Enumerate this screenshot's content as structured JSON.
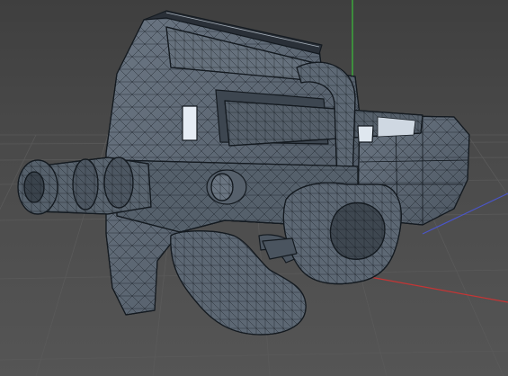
{
  "viewport": {
    "kind": "3d-modeling-viewport",
    "display_mode": "wireframe-on-shaded",
    "background_color": "#4a4a4a",
    "grid_color": "#5c5c5c",
    "model": {
      "description_icon": "submachine-gun-mesh",
      "fill_color": "#5b6673",
      "fill_dark": "#46505b",
      "fill_light": "#75808d",
      "edge_color": "#141a20"
    },
    "axes": [
      {
        "name": "y-axis",
        "color": "#3bbf3b"
      },
      {
        "name": "x-axis",
        "color": "#c43535"
      },
      {
        "name": "z-axis",
        "color": "#4a55c8"
      }
    ],
    "highlight_color": "#e6edf5"
  }
}
